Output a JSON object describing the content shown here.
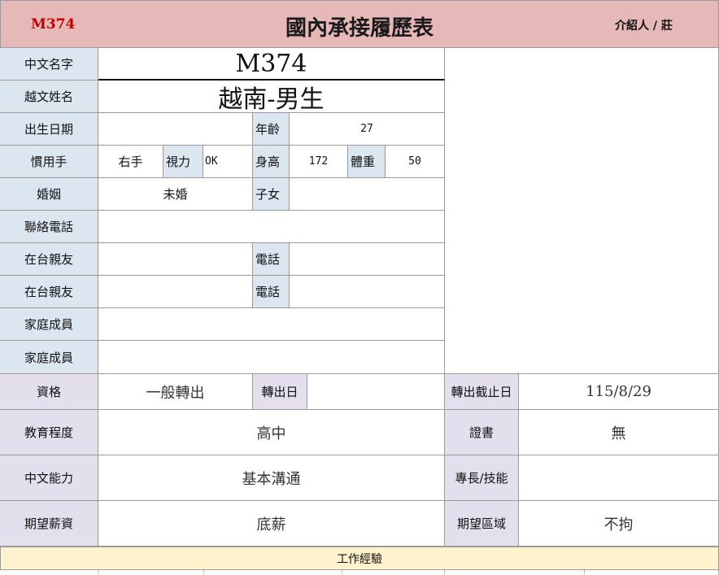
{
  "header": {
    "code": "M374",
    "title": "國內承接履歷表",
    "introducer": "介紹人 / 莊"
  },
  "labels": {
    "chinese_name": "中文名字",
    "viet_name": "越文姓名",
    "birth_date": "出生日期",
    "age": "年齡",
    "handedness": "慣用手",
    "vision": "視力",
    "height": "身高",
    "weight": "體重",
    "marriage": "婚姻",
    "children": "子女",
    "phone": "聯絡電話",
    "relative_1": "在台親友",
    "relative_phone_1": "電話",
    "relative_2": "在台親友",
    "relative_phone_2": "電話",
    "family_1": "家庭成員",
    "family_2": "家庭成員",
    "qualification": "資格",
    "transfer_date": "轉出日",
    "deadline": "轉出截止日",
    "education": "教育程度",
    "certificate": "證書",
    "chinese_ability": "中文能力",
    "skills": "專長/技能",
    "salary": "期望薪資",
    "region": "期望區域",
    "work_experience": "工作經驗"
  },
  "values": {
    "chinese_name": "M374",
    "viet_name": "越南-男生",
    "birth_date": "",
    "age": "27",
    "handedness": "右手",
    "vision": "OK",
    "height": "172",
    "weight": "50",
    "marriage": "未婚",
    "children": "",
    "phone": "",
    "relative_1": "",
    "relative_phone_1": "",
    "relative_2": "",
    "relative_phone_2": "",
    "family_1": "",
    "family_2": "",
    "qualification": "一般轉出",
    "transfer_date": "",
    "deadline": "115/8/29",
    "education": "高中",
    "certificate": "無",
    "chinese_ability": "基本溝通",
    "skills": "",
    "salary": "底薪",
    "region": "不拘"
  },
  "colors": {
    "header_bg": "#e6b8b7",
    "label_blue": "#dce6f1",
    "label_purple": "#e4dfec",
    "work_bar": "#fff2cc",
    "code_red": "#c00000"
  }
}
